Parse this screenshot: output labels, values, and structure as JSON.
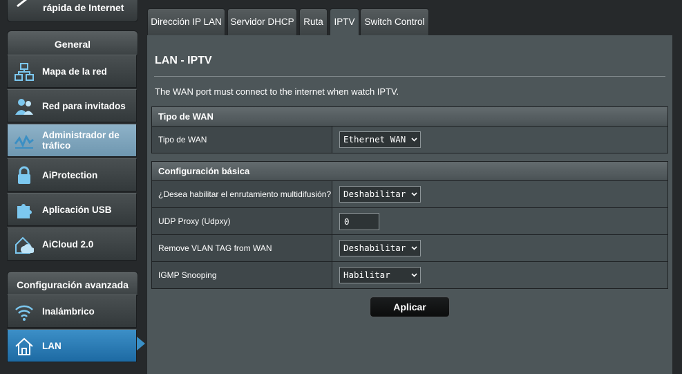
{
  "sidebar": {
    "quick_setup_label": "rápida de Internet",
    "general_header": "General",
    "general_items": [
      {
        "label": "Mapa de la red",
        "icon": "network-map-icon"
      },
      {
        "label": "Red para invitados",
        "icon": "guest-network-icon"
      },
      {
        "label": "Administrador de tráfico",
        "icon": "traffic-manager-icon"
      },
      {
        "label": "AiProtection",
        "icon": "lock-icon"
      },
      {
        "label": "Aplicación USB",
        "icon": "puzzle-icon"
      },
      {
        "label": "AiCloud 2.0",
        "icon": "cloud-house-icon"
      }
    ],
    "advanced_header": "Configuración avanzada",
    "advanced_items": [
      {
        "label": "Inalámbrico",
        "icon": "wifi-icon"
      },
      {
        "label": "LAN",
        "icon": "house-icon"
      }
    ]
  },
  "tabs": [
    {
      "label": "Dirección IP LAN"
    },
    {
      "label": "Servidor DHCP"
    },
    {
      "label": "Ruta"
    },
    {
      "label": "IPTV",
      "selected": true
    },
    {
      "label": "Switch Control"
    }
  ],
  "page": {
    "title": "LAN - IPTV",
    "description": "The WAN port must connect to the internet when watch IPTV."
  },
  "wan_section": {
    "header": "Tipo de WAN",
    "rows": [
      {
        "label": "Tipo de WAN",
        "value": "Ethernet WAN"
      }
    ]
  },
  "basic_section": {
    "header": "Configuración básica",
    "rows": [
      {
        "label": "¿Desea habilitar el enrutamiento multidifusión?",
        "value": "Deshabilitar"
      },
      {
        "label": "UDP Proxy (Udpxy)",
        "value": "0"
      },
      {
        "label": "Remove VLAN TAG from WAN",
        "value": "Deshabilitar"
      },
      {
        "label": "IGMP Snooping",
        "value": "Habilitar"
      }
    ]
  },
  "apply_label": "Aplicar",
  "colors": {
    "active_menu": "#2a7ab4",
    "highlight_menu": "#7ea5bd",
    "panel_bg": "#4d5659",
    "page_bg": "#26292b"
  }
}
